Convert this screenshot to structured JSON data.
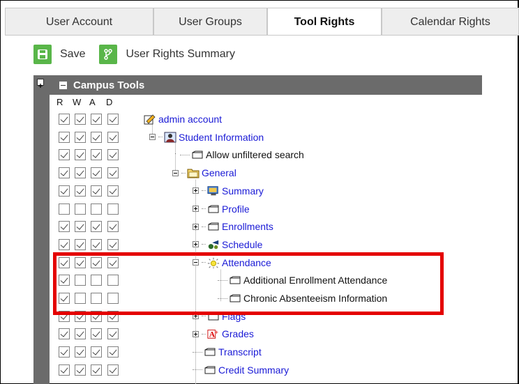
{
  "tabs": [
    {
      "label": "User Account",
      "active": false
    },
    {
      "label": "User Groups",
      "active": false
    },
    {
      "label": "Tool Rights",
      "active": true
    },
    {
      "label": "Calendar Rights",
      "active": false
    }
  ],
  "toolbar": {
    "save_label": "Save",
    "summary_label": "User Rights Summary"
  },
  "section_title": "Campus Tools",
  "columns": [
    "R",
    "W",
    "A",
    "D"
  ],
  "accent_color": "#59b649",
  "highlight_color": "#e40000",
  "rows": [
    {
      "label": "admin account",
      "style": "link",
      "rwad": [
        true,
        true,
        true,
        true
      ]
    },
    {
      "label": "Student Information",
      "style": "link",
      "rwad": [
        true,
        true,
        true,
        true
      ]
    },
    {
      "label": "Allow unfiltered search",
      "style": "plain",
      "rwad": [
        true,
        true,
        true,
        true
      ]
    },
    {
      "label": "General",
      "style": "link",
      "rwad": [
        true,
        true,
        true,
        true
      ]
    },
    {
      "label": "Summary",
      "style": "link",
      "rwad": [
        true,
        true,
        true,
        true
      ]
    },
    {
      "label": "Profile",
      "style": "link",
      "rwad": [
        false,
        false,
        false,
        false
      ]
    },
    {
      "label": "Enrollments",
      "style": "link",
      "rwad": [
        true,
        true,
        true,
        true
      ]
    },
    {
      "label": "Schedule",
      "style": "link",
      "rwad": [
        true,
        true,
        true,
        true
      ]
    },
    {
      "label": "Attendance",
      "style": "link",
      "rwad": [
        true,
        true,
        true,
        true
      ]
    },
    {
      "label": "Additional Enrollment Attendance",
      "style": "plain",
      "rwad": [
        true,
        false,
        false,
        false
      ]
    },
    {
      "label": "Chronic Absenteeism Information",
      "style": "plain",
      "rwad": [
        true,
        false,
        false,
        false
      ]
    },
    {
      "label": "Flags",
      "style": "link",
      "rwad": [
        true,
        true,
        true,
        true
      ]
    },
    {
      "label": "Grades",
      "style": "link",
      "rwad": [
        true,
        true,
        true,
        true
      ]
    },
    {
      "label": "Transcript",
      "style": "link",
      "rwad": [
        true,
        true,
        true,
        true
      ]
    },
    {
      "label": "Credit Summary",
      "style": "link",
      "rwad": [
        true,
        true,
        true,
        true
      ]
    }
  ]
}
